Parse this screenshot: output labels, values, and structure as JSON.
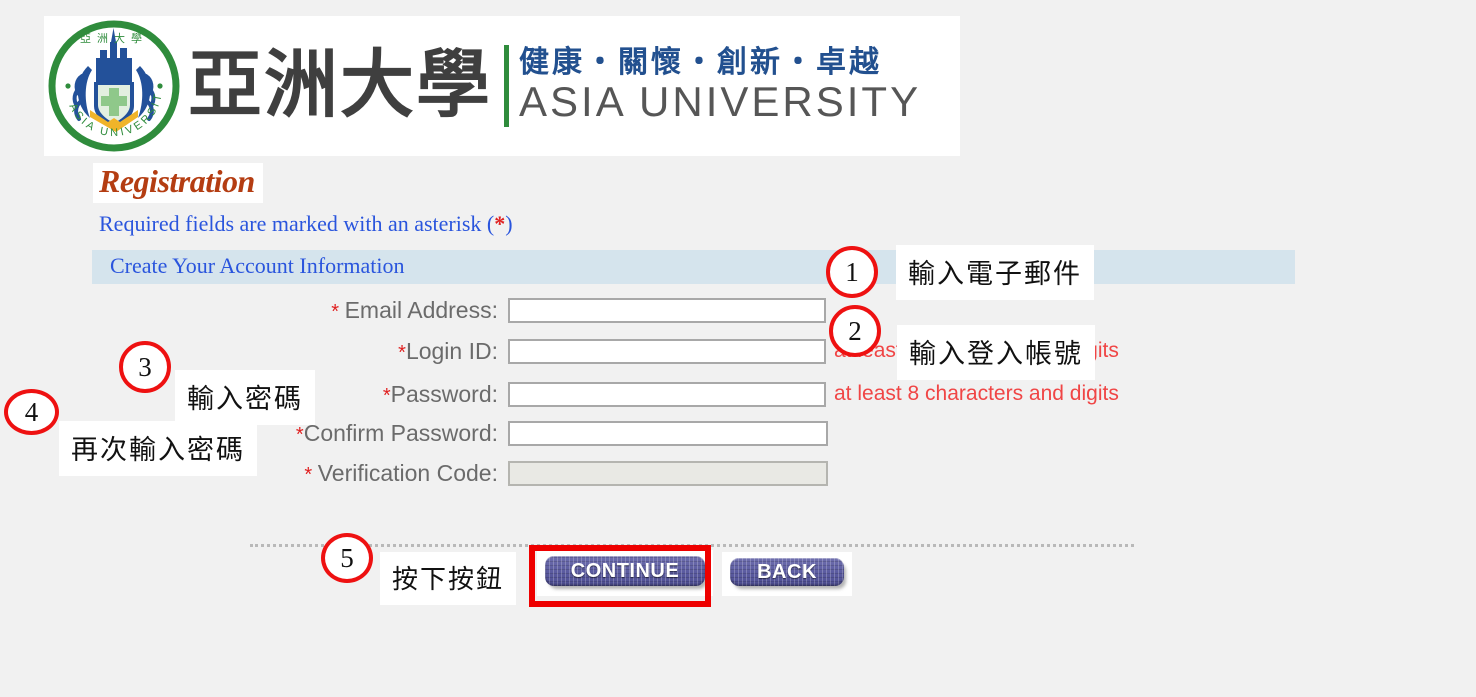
{
  "logo": {
    "chinese_name": "亞洲大學",
    "motto": "健康・關懷・創新・卓越",
    "english_name": "ASIA UNIVERSITY",
    "emblem_alt": "asia-university-emblem"
  },
  "page": {
    "title": "Registration",
    "required_note_prefix": "Required fields are marked with an asterisk (",
    "required_note_asterisk": "*",
    "required_note_suffix": ")",
    "section_header": "Create Your Account Information"
  },
  "form": {
    "fields": [
      {
        "label_prefix": "* ",
        "label": "Email Address:",
        "value": "",
        "placeholder": "",
        "hint": "",
        "disabled": false
      },
      {
        "label_prefix": "*",
        "label": "Login ID:",
        "value": "",
        "placeholder": "",
        "hint": "at least 8 characters and digits",
        "disabled": false
      },
      {
        "label_prefix": "*",
        "label": "Password:",
        "value": "",
        "placeholder": "",
        "hint": "at least 8 characters and digits",
        "disabled": false
      },
      {
        "label_prefix": "*",
        "label": "Confirm Password:",
        "value": "",
        "placeholder": "",
        "hint": "",
        "disabled": false
      },
      {
        "label_prefix": "* ",
        "label": "Verification Code:",
        "value": "",
        "placeholder": "",
        "hint": "",
        "disabled": true
      }
    ]
  },
  "buttons": {
    "continue_label": "CONTINUE",
    "back_label": "BACK"
  },
  "annotations": [
    {
      "number": "1",
      "text": "輸入電子郵件"
    },
    {
      "number": "2",
      "text": "輸入登入帳號"
    },
    {
      "number": "3",
      "text": "輸入密碼"
    },
    {
      "number": "4",
      "text": "再次輸入密碼"
    },
    {
      "number": "5",
      "text": "按下按鈕"
    }
  ],
  "colors": {
    "page_background": "#f1f1f1",
    "section_bar": "#d5e4ed",
    "link_blue": "#2a55dd",
    "title_rust": "#b43d12",
    "hint_red": "#f04545",
    "annotation_red": "#ee1111",
    "highlight_red": "#ee0000",
    "button_purple": "#5a5a9f",
    "emblem_green": "#2f8c3c",
    "emblem_blue": "#22508f"
  }
}
